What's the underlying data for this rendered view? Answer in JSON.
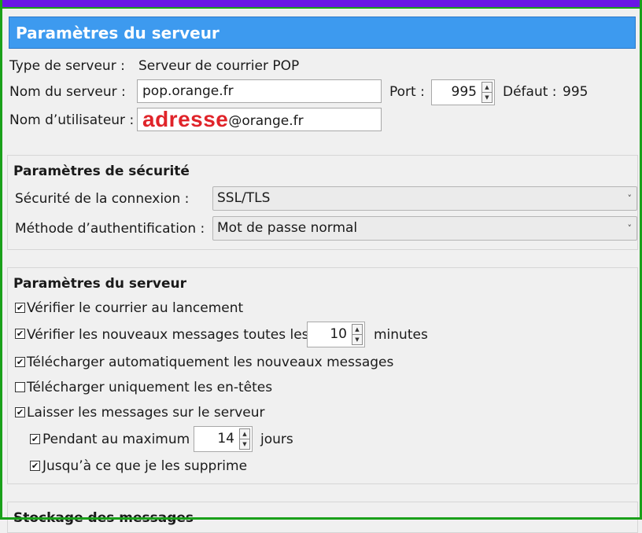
{
  "banner": {
    "title": "Paramètres du serveur"
  },
  "server": {
    "type_label": "Type de serveur :",
    "type_value": "Serveur de courrier POP",
    "name_label": "Nom du serveur :",
    "name_value": "pop.orange.fr",
    "port_label": "Port :",
    "port_value": "995",
    "default_label": "Défaut :",
    "default_value": "995",
    "user_label": "Nom d’utilisateur :",
    "user_value_red": "adresse",
    "user_value_suffix": "@orange.fr"
  },
  "security": {
    "title": "Paramètres de sécurité",
    "connection_label": "Sécurité de la connexion :",
    "connection_value": "SSL/TLS",
    "auth_label": "Méthode d’authentification :",
    "auth_value": "Mot de passe normal"
  },
  "server_settings": {
    "title": "Paramètres du serveur",
    "check_on_start": {
      "label": "Vérifier le courrier au lancement",
      "checked": true
    },
    "check_every": {
      "label": "Vérifier les nouveaux messages toutes les",
      "checked": true,
      "value": "10",
      "unit": "minutes"
    },
    "auto_download": {
      "label": "Télécharger automatiquement les nouveaux messages",
      "checked": true
    },
    "headers_only": {
      "label": "Télécharger uniquement les en-têtes",
      "checked": false
    },
    "leave_on_server": {
      "label": "Laisser les messages sur le serveur",
      "checked": true
    },
    "max_days": {
      "label": "Pendant au maximum",
      "checked": true,
      "value": "14",
      "unit": "jours"
    },
    "until_deleted": {
      "label": "Jusqu’à ce que je les supprime",
      "checked": true
    }
  },
  "storage": {
    "title": "Stockage des messages"
  }
}
